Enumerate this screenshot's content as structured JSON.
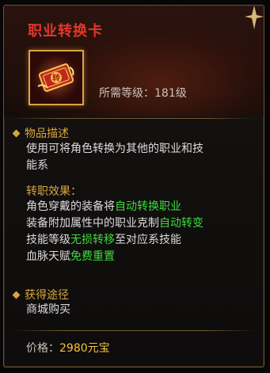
{
  "item": {
    "name": "职业转换卡",
    "level_label": "所需等级：",
    "level_value": "181级",
    "icon": "transfer-card-icon",
    "icon_glyph": "转"
  },
  "description": {
    "title": "物品描述",
    "line1": "使用可将角色转换为其他的职业和技",
    "line2": "能系"
  },
  "effect": {
    "title": "转职效果：",
    "lines": [
      [
        {
          "t": "角色穿戴的装备将",
          "g": false
        },
        {
          "t": "自动转换职业",
          "g": true
        }
      ],
      [
        {
          "t": "装备附加属性中的职业克制",
          "g": false
        },
        {
          "t": "自动转变",
          "g": true
        }
      ],
      [
        {
          "t": "技能等级",
          "g": false
        },
        {
          "t": "无损转移",
          "g": true
        },
        {
          "t": "至对应系技能",
          "g": false
        }
      ],
      [
        {
          "t": "血脉天赋",
          "g": false
        },
        {
          "t": "免费重置",
          "g": true
        }
      ]
    ]
  },
  "obtain": {
    "title": "获得途径",
    "line1": "商城购买"
  },
  "price": {
    "label": "价格：",
    "value": "2980元宝"
  },
  "colors": {
    "title": "#e0382a",
    "gold": "#d8a640",
    "green": "#3fdb3f",
    "text": "#dcdcdc"
  }
}
